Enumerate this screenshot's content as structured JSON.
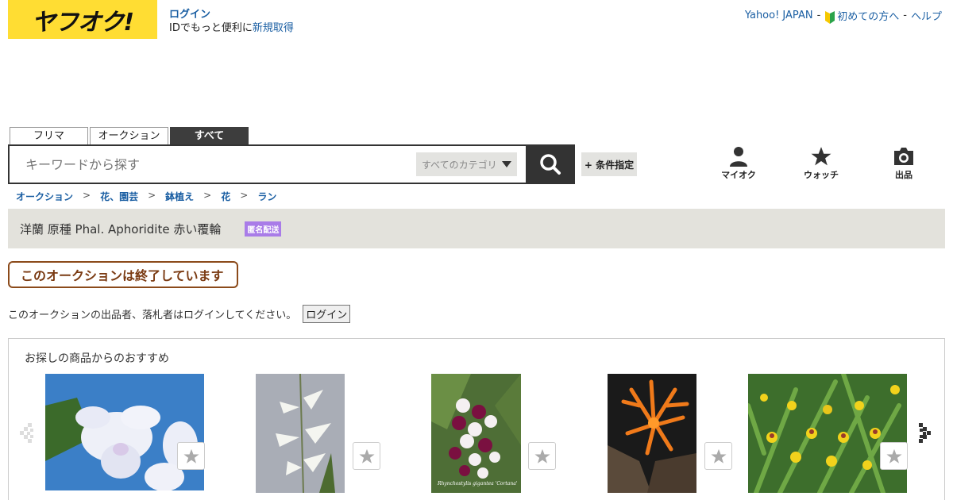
{
  "header": {
    "logo_text": "ヤフオク!",
    "login_link": "ログイン",
    "login_desc": "IDでもっと便利に",
    "register_link": "新規取得",
    "top_links": {
      "yahoo": "Yahoo! JAPAN",
      "sep1": "-",
      "beginner": "初めての方へ",
      "sep2": "-",
      "help": "ヘルプ"
    }
  },
  "search": {
    "tabs": [
      {
        "label": "フリマ"
      },
      {
        "label": "オークション"
      },
      {
        "label": "すべて"
      }
    ],
    "placeholder": "キーワードから探す",
    "category": "すべてのカテゴリ",
    "advanced": "+ 条件指定"
  },
  "quick_menu": {
    "myauction": "マイオク",
    "watch": "ウォッチ",
    "sell": "出品"
  },
  "breadcrumb": [
    "オークション",
    "花、園芸",
    "鉢植え",
    "花",
    "ラン"
  ],
  "breadcrumb_sep": ">",
  "item": {
    "title": "洋蘭 原種 Phal. Aphoridite 赤い覆輪",
    "badge": "匿名配送"
  },
  "status": {
    "ended": "このオークションは終了しています",
    "login_note": "このオークションの出品者、落札者はログインしてください。",
    "login_button": "ログイン"
  },
  "recommend": {
    "title": "お探しの商品からのおすすめ",
    "img3_caption": "Rhynchostylis gigantea 'Cortana'"
  },
  "colors": {
    "logo_bg": "#ffdd33",
    "link": "#1b5fa3",
    "badge": "#a97ce8",
    "ended_border": "#8b4a1a"
  }
}
